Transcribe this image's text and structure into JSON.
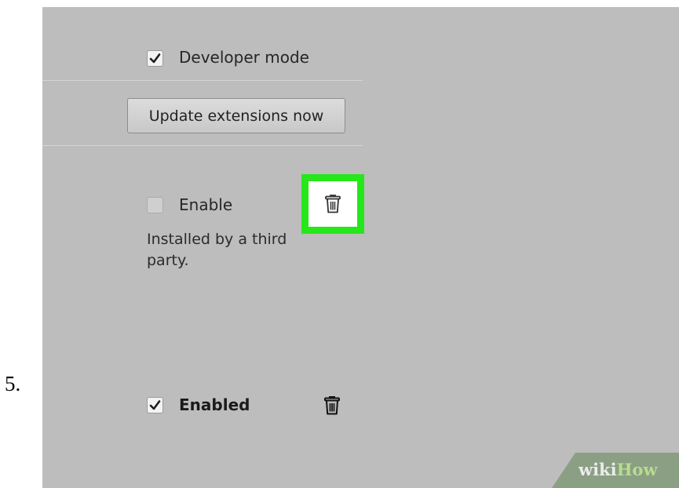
{
  "step": {
    "number": "5."
  },
  "settings": {
    "developer_mode": {
      "label": "Developer mode",
      "checked": true
    },
    "update_button": {
      "label": "Update extensions now"
    }
  },
  "extensions": [
    {
      "toggle_label": "Enable",
      "checked": false,
      "note": "Installed by a third party.",
      "remove_icon": "trash-icon",
      "highlighted": true
    },
    {
      "toggle_label": "Enabled",
      "checked": true,
      "remove_icon": "trash-icon",
      "highlighted": false
    }
  ],
  "colors": {
    "highlight": "#26e71a",
    "panel": "#bdbdbd"
  },
  "watermark": {
    "part1": "wiki",
    "part2": "How"
  }
}
